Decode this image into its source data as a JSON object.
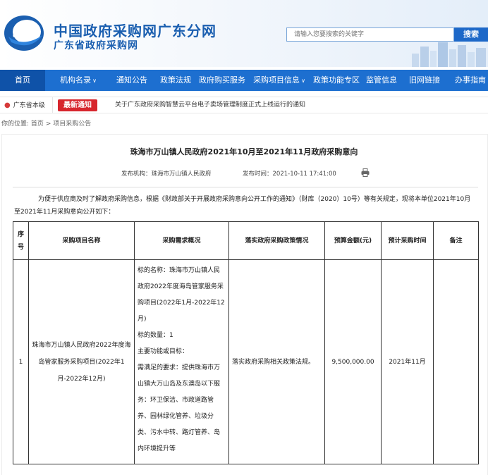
{
  "header": {
    "logo_text": "GDGPO",
    "title": "中国政府采购网广东分网",
    "subtitle": "广东省政府采购网",
    "search_placeholder": "请输入您要搜索的关键字",
    "search_button": "搜索"
  },
  "nav": {
    "items": [
      {
        "label": "首页",
        "active": true
      },
      {
        "label": "机构名录",
        "dropdown": true
      },
      {
        "label": "通知公告"
      },
      {
        "label": "政策法规"
      },
      {
        "label": "政府购买服务"
      },
      {
        "label": "采购项目信息",
        "dropdown": true
      },
      {
        "label": "政策功能专区"
      },
      {
        "label": "监管信息"
      },
      {
        "label": "旧网链接"
      },
      {
        "label": "办事指南"
      }
    ],
    "caret": "∨"
  },
  "notice": {
    "region": "广东省本级",
    "tag": "最新通知",
    "text": "关于广东政府采购智慧云平台电子卖场管理制度正式上线运行的通知"
  },
  "breadcrumb": {
    "prefix": "你的位置:",
    "home": "首页",
    "sep": ">",
    "current": "项目采购公告"
  },
  "article": {
    "title": "珠海市万山镇人民政府2021年10月至2021年11月政府采购意向",
    "publisher": "发布机构：珠海市万山镇人民政府",
    "publish_time": "发布时间：2021-10-11 17:41:00",
    "intro_line1": "为便于供应商及时了解政府采购信息，根据《财政部关于开展政府采购意向公开工作的通知》（财库（2020）10号）等有关规定，现将本单位2021年10月",
    "intro_line2": "至2021年11月采购意向公开如下："
  },
  "table": {
    "headers": {
      "seq": "序号",
      "name": "采购项目名称",
      "desc": "采购需求概况",
      "policy": "落实政府采购政策情况",
      "budget": "预算金额(元)",
      "time": "预计采购时间",
      "note": "备注"
    },
    "rows": [
      {
        "seq": "1",
        "name": "珠海市万山镇人民政府2022年度海岛管家服务采购项目(2022年1月-2022年12月)",
        "desc": "标的名称：珠海市万山镇人民政府2022年度海岛管家服务采购项目(2022年1月-2022年12月)\n标的数量：1\n主要功能或目标：\n需满足的要求：提供珠海市万山镇大万山岛及东澳岛以下服务：环卫保洁、市政道路管养、园林绿化管养、垃圾分类、污水中转、路灯管养、岛内环境提升等",
        "policy": "落实政府采购相关政策法规。",
        "budget": "9,500,000.00",
        "time": "2021年11月",
        "note": ""
      }
    ]
  },
  "colors": {
    "brand_blue": "#1b5fb0",
    "nav_blue": "#1d6fd0",
    "nav_active": "#0f52a8",
    "notice_red": "#d7262d"
  }
}
